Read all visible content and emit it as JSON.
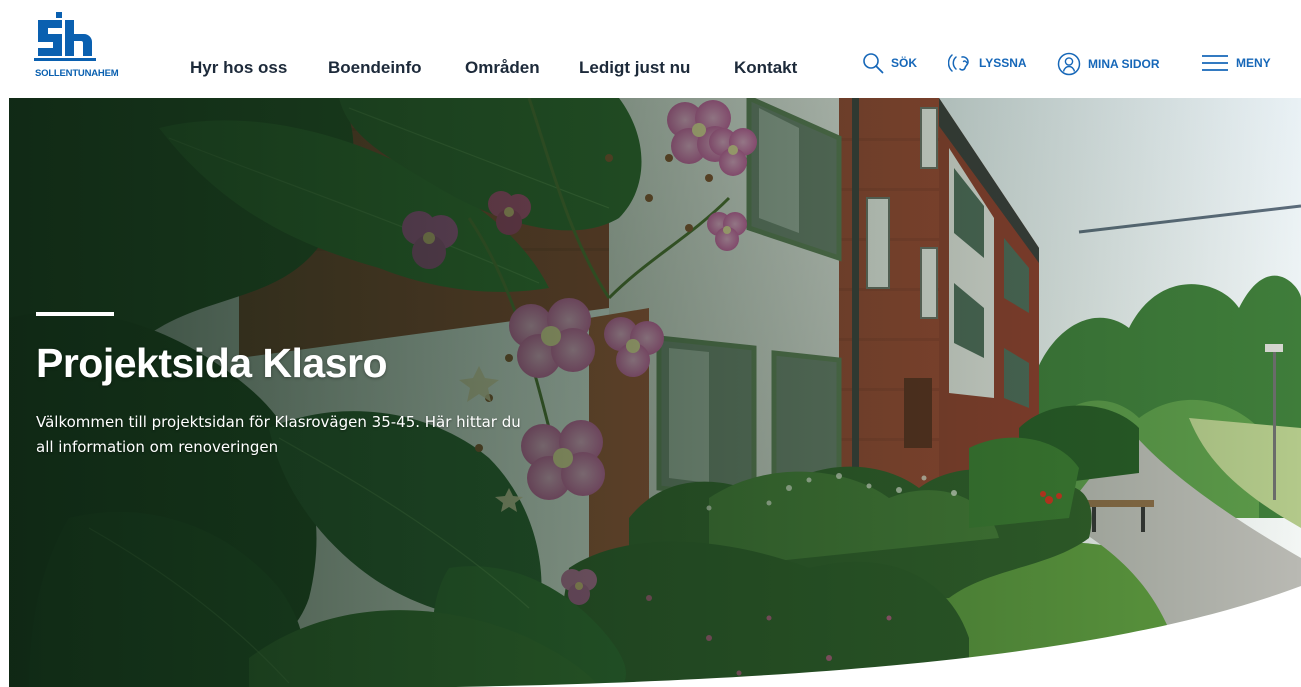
{
  "brand": {
    "name": "SOLLENTUNAHEM",
    "color": "#0a60b0"
  },
  "nav": {
    "items": [
      {
        "label": "Hyr hos oss"
      },
      {
        "label": "Boendeinfo"
      },
      {
        "label": "Områden"
      },
      {
        "label": "Ledigt just nu"
      },
      {
        "label": "Kontakt"
      }
    ]
  },
  "tools": {
    "search_label": "SÖK",
    "listen_label": "LYSSNA",
    "account_label": "MINA SIDOR",
    "menu_label": "MENY",
    "icons": [
      "search-icon",
      "listen-icon",
      "account-icon",
      "menu-icon"
    ],
    "accent": "#1667b8"
  },
  "hero": {
    "title": "Projektsida Klasro",
    "description": "Välkommen till projektsidan för Klasrovägen 35-45. Här hittar du all information om renoveringen"
  }
}
